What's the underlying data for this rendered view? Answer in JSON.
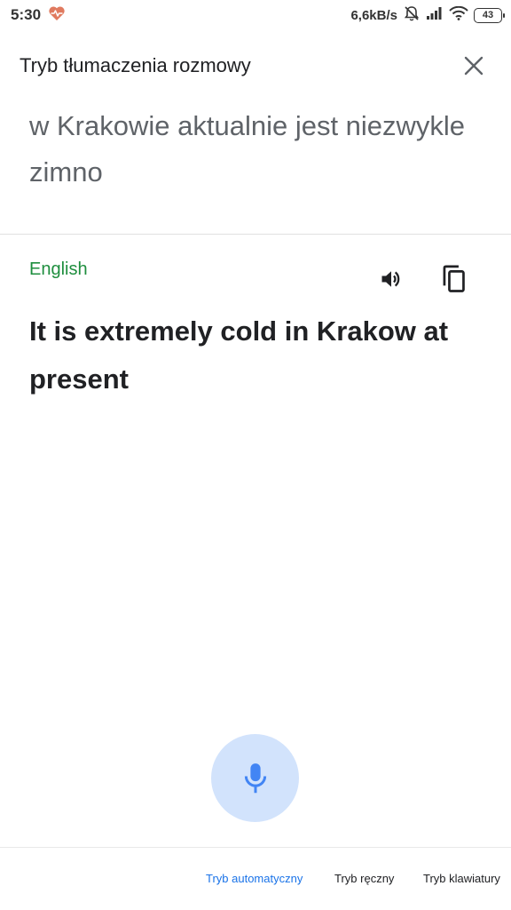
{
  "status_bar": {
    "time": "5:30",
    "net_speed": "6,6kB/s",
    "battery": "43",
    "icons": [
      "health-icon",
      "alarm-off-icon",
      "signal-icon",
      "wifi-icon",
      "battery-icon"
    ]
  },
  "header": {
    "title": "Tryb tłumaczenia rozmowy",
    "close_icon": "close-icon"
  },
  "source": {
    "text": "w Krakowie aktualnie jest niezwykle zimno"
  },
  "result": {
    "language": "English",
    "text": "It is extremely cold in Krakow at present",
    "actions": [
      "speaker-icon",
      "copy-icon"
    ]
  },
  "mic": {
    "icon": "microphone-icon"
  },
  "modes": {
    "auto": "Tryb automatyczny",
    "manual": "Tryb ręczny",
    "keyboard": "Tryb klawiatury",
    "active": "auto"
  },
  "colors": {
    "language_green": "#1e8e3e",
    "accent_blue": "#1a73e8",
    "mic_bg": "#d2e3fc",
    "mic_icon": "#4285f4",
    "health_icon": "#e07a5f"
  }
}
